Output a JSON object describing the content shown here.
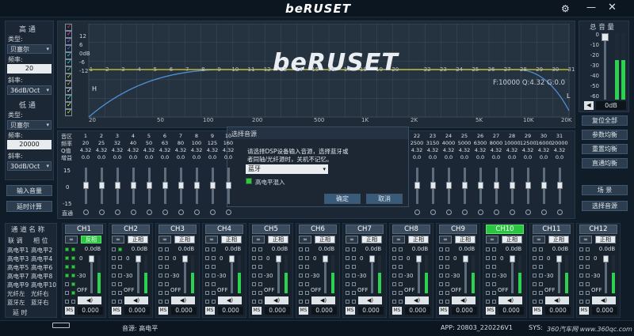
{
  "brand": "beRUSET",
  "watermark_logo": "beRUSET",
  "left": {
    "hp_title": "高 通",
    "type_label": "类型:",
    "hp_type": "贝塞尔",
    "freq_label": "频率:",
    "hp_freq": "20",
    "slope_label": "斜率:",
    "hp_slope": "36dB/Oct",
    "lp_title": "低 通",
    "lp_type": "贝塞尔",
    "lp_freq": "20000",
    "lp_slope": "30dB/Oct",
    "input_btn": "输入音量",
    "delay_btn": "延时计算"
  },
  "graph": {
    "db_labels": [
      "12",
      "6",
      "0dB",
      "-6",
      "-12"
    ],
    "freq_ticks": [
      "20",
      "50",
      "100",
      "200",
      "500",
      "1K",
      "2K",
      "5K",
      "10K",
      "20K"
    ],
    "band_numbers": [
      "1",
      "2",
      "3",
      "4",
      "5",
      "6",
      "7",
      "8",
      "9",
      "10",
      "11",
      "12",
      "13",
      "14",
      "15",
      "16",
      "17",
      "18",
      "19",
      "20",
      "21",
      "22",
      "23",
      "24",
      "25",
      "26",
      "27",
      "28",
      "29",
      "30",
      "31"
    ],
    "readout": "F:10000 Q:4.32 G:0.0",
    "h_marker": "H",
    "l_marker": "L",
    "check_colors": [
      "#ff2b2b",
      "#ff3ad7",
      "#b43cff",
      "#3b6bff",
      "#25d0ff",
      "#1fe0c0",
      "#3ae04a",
      "#c8e030",
      "#f0b020",
      "#ffffff",
      "#30ff90",
      "#e8ff40",
      "#e0e020"
    ]
  },
  "eq": {
    "row_labels": [
      "音区",
      "频率",
      "Q值",
      "增益"
    ],
    "bands": [
      "1",
      "2",
      "3",
      "4",
      "5",
      "6",
      "7",
      "8",
      "9",
      "10"
    ],
    "freqs": [
      "20",
      "25",
      "32",
      "40",
      "50",
      "63",
      "80",
      "100",
      "125",
      "160"
    ],
    "qs": [
      "4.32",
      "4.32",
      "4.32",
      "4.32",
      "4.32",
      "4.32",
      "4.32",
      "4.32",
      "4.32",
      "4.32"
    ],
    "gains": [
      "0.0",
      "0.0",
      "0.0",
      "0.0",
      "0.0",
      "0.0",
      "0.0",
      "0.0",
      "0.0",
      "0.0"
    ],
    "bands_r": [
      "22",
      "23",
      "24",
      "25",
      "26",
      "27",
      "28",
      "29",
      "30",
      "31"
    ],
    "freqs_r": [
      "2500",
      "3150",
      "4000",
      "5000",
      "6300",
      "8000",
      "10000",
      "12500",
      "16000",
      "20000"
    ],
    "qs_r": [
      "4.32",
      "4.32",
      "4.32",
      "4.32",
      "4.32",
      "4.32",
      "4.32",
      "4.32",
      "4.32",
      "4.32"
    ],
    "gains_r": [
      "0.0",
      "0.0",
      "0.0",
      "0.0",
      "0.0",
      "0.0",
      "0.0",
      "0.0",
      "0.0",
      "0.0"
    ],
    "scale_top": "15",
    "scale_mid": "0",
    "scale_bot": "-15",
    "passthrough": "直通"
  },
  "modal": {
    "title": "选择音源",
    "line1": "请选择DSP设备输入音源，选择蓝牙或",
    "line2": "者同轴/光纤源时，关机不记忆。",
    "source": "蓝牙",
    "mix_label": "高电平混入",
    "ok": "确定",
    "cancel": "取消"
  },
  "right": {
    "master_title": "总 音 量",
    "scale": [
      "0",
      "-10",
      "-20",
      "-30",
      "-40",
      "-50",
      "-60"
    ],
    "master_db": "0dB",
    "reset_btn": "复位全部",
    "param_btn": "参数均衡",
    "rebuild_btn": "重置均衡",
    "direct_btn": "直通均衡",
    "scene_btn": "场 景",
    "select_scene_btn": "选择音源"
  },
  "routing": {
    "title": "通 道 名 称",
    "link": "联 调",
    "phase": "相 位",
    "rows": [
      [
        "高电平1",
        "高电平2"
      ],
      [
        "高电平3",
        "高电平4"
      ],
      [
        "高电平5",
        "高电平6"
      ],
      [
        "高电平7",
        "高电平8"
      ],
      [
        "高电平9",
        "高电平10"
      ],
      [
        "光纤左",
        "光纤右"
      ],
      [
        "蓝牙左",
        "蓝牙右"
      ]
    ],
    "delay": "延 时"
  },
  "channels": [
    {
      "name": "CH1",
      "phase": "反相",
      "db": "0.0dB",
      "val": "0.000"
    },
    {
      "name": "CH2",
      "phase": "正相",
      "db": "0.0dB",
      "val": "0.000"
    },
    {
      "name": "CH3",
      "phase": "正相",
      "db": "0.0dB",
      "val": "0.000"
    },
    {
      "name": "CH4",
      "phase": "正相",
      "db": "0.0dB",
      "val": "0.000"
    },
    {
      "name": "CH5",
      "phase": "正相",
      "db": "0.0dB",
      "val": "0.000"
    },
    {
      "name": "CH6",
      "phase": "正相",
      "db": "0.0dB",
      "val": "0.000"
    },
    {
      "name": "CH7",
      "phase": "正相",
      "db": "0.0dB",
      "val": "0.000"
    },
    {
      "name": "CH8",
      "phase": "正相",
      "db": "0.0dB",
      "val": "0.000"
    },
    {
      "name": "CH9",
      "phase": "正相",
      "db": "0.0dB",
      "val": "0.000"
    },
    {
      "name": "CH10",
      "phase": "正相",
      "db": "0.0dB",
      "val": "0.000"
    },
    {
      "name": "CH11",
      "phase": "正相",
      "db": "0.0dB",
      "val": "0.000"
    },
    {
      "name": "CH12",
      "phase": "正相",
      "db": "0.0dB",
      "val": "0.000"
    }
  ],
  "channel_scale": {
    "zero": "0",
    "m30": "-30",
    "off": "OFF",
    "ms": "MS"
  },
  "status": {
    "source": "音源: 高电平",
    "app": "APP: 20803_220226V1",
    "sys": "SYS:"
  },
  "footer_watermark": "360汽车网 www.360qc.com"
}
